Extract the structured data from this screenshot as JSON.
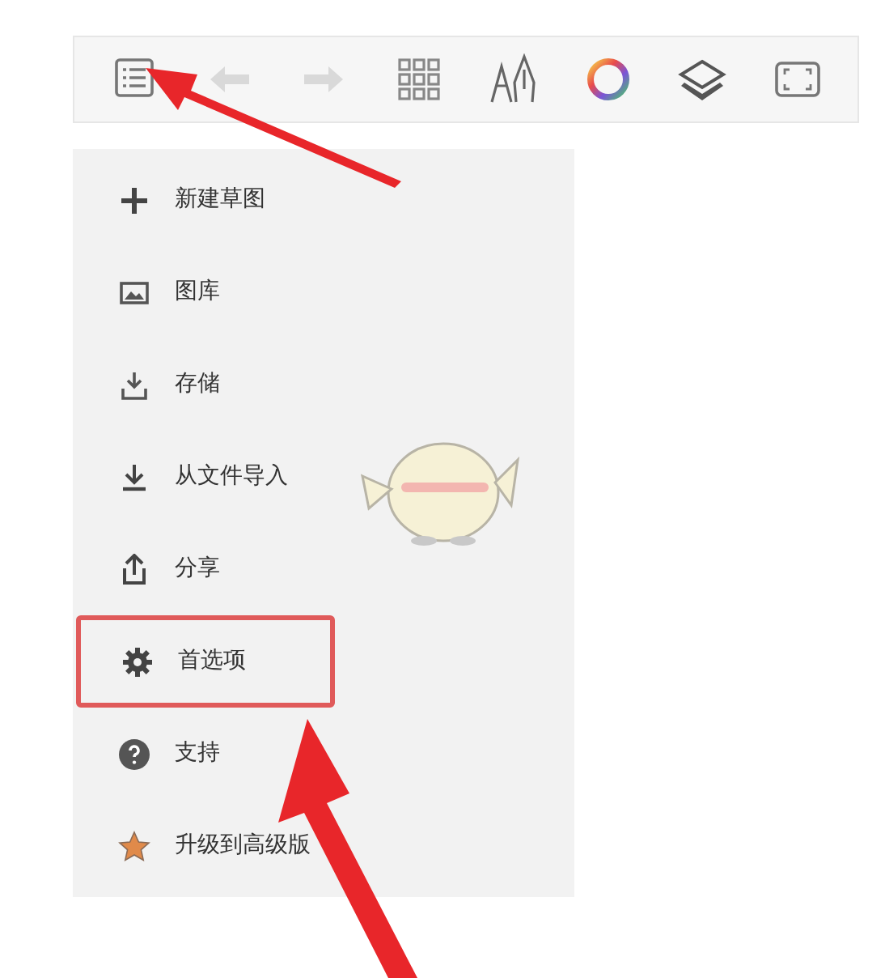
{
  "toolbar": [
    {
      "kind": "list",
      "disabled": false
    },
    {
      "kind": "undo",
      "disabled": true
    },
    {
      "kind": "redo",
      "disabled": true
    },
    {
      "kind": "grid",
      "disabled": false
    },
    {
      "kind": "pens",
      "disabled": false
    },
    {
      "kind": "color",
      "disabled": false
    },
    {
      "kind": "layers",
      "disabled": false
    },
    {
      "kind": "fullscreen",
      "disabled": false
    }
  ],
  "menu": [
    {
      "kind": "plus",
      "label": "新建草图",
      "highlighted": false
    },
    {
      "kind": "gallery",
      "label": "图库",
      "highlighted": false
    },
    {
      "kind": "save",
      "label": "存储",
      "highlighted": false
    },
    {
      "kind": "import",
      "label": "从文件导入",
      "highlighted": false
    },
    {
      "kind": "share",
      "label": "分享",
      "highlighted": false
    },
    {
      "kind": "gear",
      "label": "首选项",
      "highlighted": true
    },
    {
      "kind": "help",
      "label": "支持",
      "highlighted": false
    },
    {
      "kind": "star",
      "label": "升级到高级版",
      "highlighted": false
    }
  ]
}
